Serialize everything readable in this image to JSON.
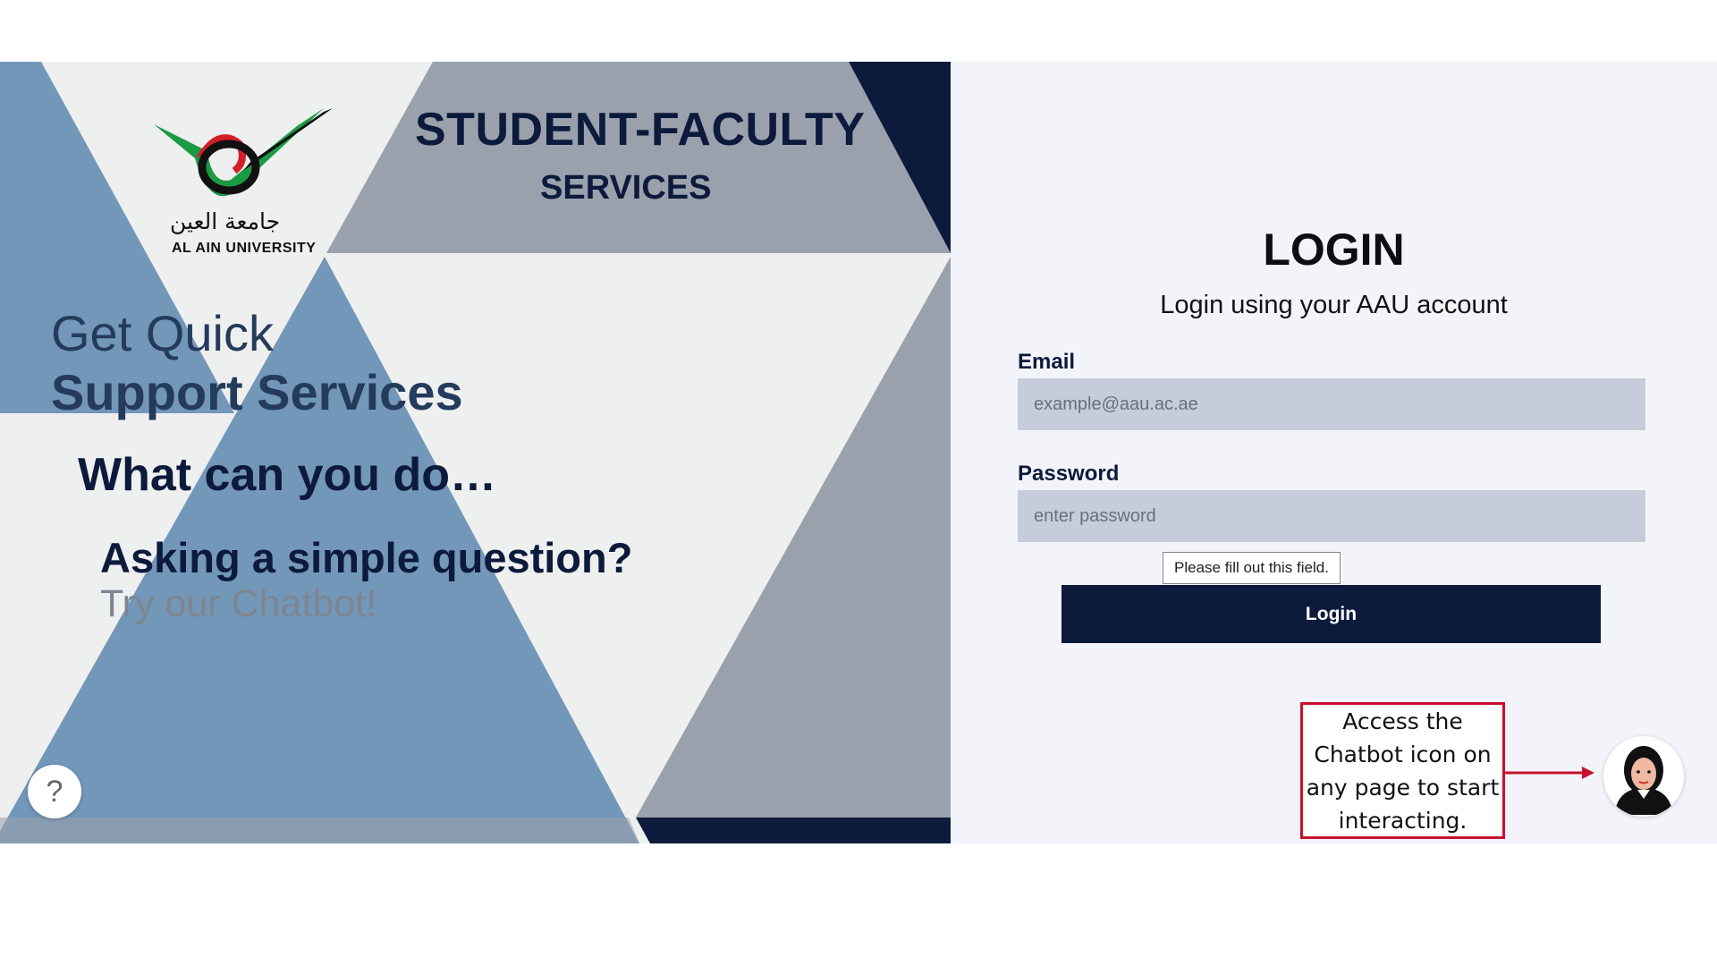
{
  "header": {
    "logo_arabic": "جامعة العين",
    "logo_english": "AL AIN UNIVERSITY",
    "title_line1": "STUDENT-FACULTY",
    "title_line2": "SERVICES"
  },
  "hero": {
    "line1": "Get Quick",
    "line2": "Support Services",
    "question": "What can you do…",
    "ask": "Asking a simple question?",
    "try": "Try our Chatbot!"
  },
  "help_button": {
    "icon": "question-mark-icon",
    "glyph": "?"
  },
  "login": {
    "title": "LOGIN",
    "subtitle": "Login using your AAU account",
    "email_label": "Email",
    "email_placeholder": "example@aau.ac.ae",
    "email_value": "",
    "password_label": "Password",
    "password_placeholder": "enter password",
    "password_value": "",
    "validation_tooltip": "Please fill out this field.",
    "button_label": "Login"
  },
  "annotation": {
    "text": "Access the Chatbot icon on any page to start interacting.",
    "color": "#c8102e"
  },
  "chatbot": {
    "icon": "chatbot-avatar-icon"
  },
  "colors": {
    "navy": "#0c1a3c",
    "steel_blue": "#7397b9",
    "slate_gray": "#9ba1ac",
    "field_bg": "#c6ccda",
    "panel_bg": "#f3f4f9"
  }
}
